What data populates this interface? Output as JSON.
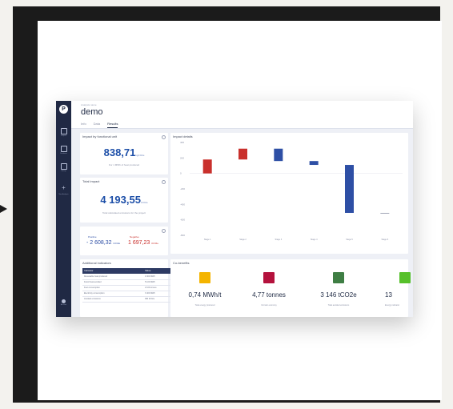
{
  "breadcrumb": "Analysis name",
  "project_title": "demo",
  "tabs": [
    {
      "label": "Info"
    },
    {
      "label": "Data"
    },
    {
      "label": "Results"
    }
  ],
  "sidebar": {
    "logo_text": "P",
    "items": [
      {
        "label": "Projects",
        "icon": "document-icon"
      },
      {
        "label": "Database",
        "icon": "database-icon"
      },
      {
        "label": "Library",
        "icon": "library-icon"
      },
      {
        "label": "New Analysis",
        "icon": "plus-icon"
      }
    ],
    "user_label": "Account"
  },
  "impact_functional": {
    "title": "Impact by functional unit",
    "value": "838,71",
    "unit": "kgCO2e",
    "note": "For 1 MWh of heat produced"
  },
  "total_impact": {
    "title": "Total impact",
    "value": "4 193,55",
    "unit": "tCO2e",
    "note": "Total calculated emissions for the project"
  },
  "delta": {
    "left_label": "Positive",
    "left_value": "- 2 608,32",
    "left_unit": "tCO2e",
    "right_label": "Negative",
    "right_value": "1 697,23",
    "right_unit": "tCO2e"
  },
  "indicators": {
    "title": "Additional indicators",
    "headers": [
      "Indicator",
      "Value"
    ],
    "rows": [
      [
        "Renewable heat produced",
        "4 300 MWh"
      ],
      [
        "Fossil heat avoided",
        "5 100 MWh"
      ],
      [
        "Fuel consumption",
        "2 100 tonnes"
      ],
      [
        "Electricity consumption",
        "3 400 MWh"
      ],
      [
        "Avoided emissions",
        "380 tCO2e"
      ]
    ]
  },
  "chart_title": "Impact details",
  "co_benefits": {
    "title": "Co-benefits",
    "items": [
      {
        "value": "0,74 MWh/t",
        "label": "Total energy produced",
        "color": "#f4b400"
      },
      {
        "value": "4,77 tonnes",
        "label": "Circular economy",
        "color": "#b4123d"
      },
      {
        "value": "3 146 tCO2e",
        "label": "Total avoided emissions",
        "color": "#3f7e44"
      },
      {
        "value": "13",
        "label": "Energy indicator",
        "color": "#56c02b"
      }
    ]
  },
  "chart_data": {
    "type": "bar",
    "title": "Impact details",
    "categories": [
      "Stage 1",
      "Stage 2",
      "Stage 3",
      "Stage 4",
      "Stage 5",
      "Stage 6"
    ],
    "values": [
      180,
      140,
      -160,
      -50,
      -620,
      0
    ],
    "ylim": [
      -800,
      400
    ],
    "yticks": [
      "400",
      "200",
      "0",
      "-200",
      "-400",
      "-600",
      "-800"
    ],
    "colors": [
      "#c9302c",
      "#c9302c",
      "#2e4fa5",
      "#2e4fa5",
      "#2e4fa5",
      "#2e4fa5"
    ]
  }
}
